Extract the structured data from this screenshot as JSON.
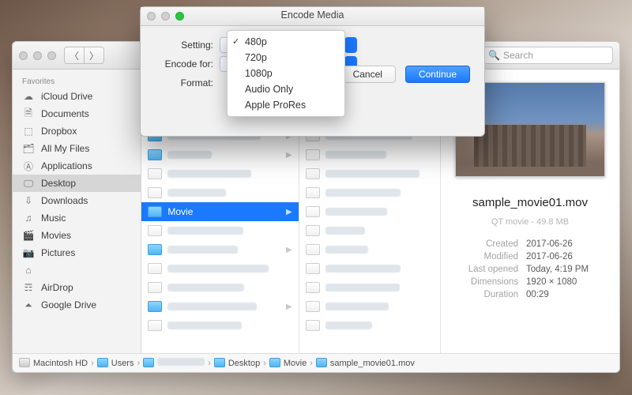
{
  "finder": {
    "search_placeholder": "Search",
    "sidebar": {
      "header": "Favorites",
      "items": [
        {
          "label": "iCloud Drive",
          "icon": "cloud"
        },
        {
          "label": "Documents",
          "icon": "doc"
        },
        {
          "label": "Dropbox",
          "icon": "dropbox"
        },
        {
          "label": "All My Files",
          "icon": "allfiles"
        },
        {
          "label": "Applications",
          "icon": "apps"
        },
        {
          "label": "Desktop",
          "icon": "desktop"
        },
        {
          "label": "Downloads",
          "icon": "downloads"
        },
        {
          "label": "Music",
          "icon": "music"
        },
        {
          "label": "Movies",
          "icon": "movies"
        },
        {
          "label": "Pictures",
          "icon": "pictures"
        },
        {
          "label": "",
          "icon": "home"
        },
        {
          "label": "AirDrop",
          "icon": "airdrop"
        },
        {
          "label": "Google Drive",
          "icon": "gdrive"
        }
      ],
      "selected_index": 5
    },
    "selected_folder": "Movie",
    "preview": {
      "filename": "sample_movie01.mov",
      "kind_line": "QT movie - 49.8 MB",
      "rows": [
        {
          "label": "Created",
          "value": "2017-06-26"
        },
        {
          "label": "Modified",
          "value": "2017-06-26"
        },
        {
          "label": "Last opened",
          "value": "Today, 4:19 PM"
        },
        {
          "label": "Dimensions",
          "value": "1920 × 1080"
        },
        {
          "label": "Duration",
          "value": "00:29"
        }
      ]
    },
    "path": [
      "Macintosh HD",
      "Users",
      "",
      "Desktop",
      "Movie",
      "sample_movie01.mov"
    ]
  },
  "dialog": {
    "title": "Encode Media",
    "labels": [
      "Setting:",
      "Encode for:",
      "Format:"
    ],
    "cancel": "Cancel",
    "continue": "Continue",
    "menu": {
      "options": [
        "480p",
        "720p",
        "1080p",
        "Audio Only",
        "Apple ProRes"
      ],
      "selected_index": 0
    }
  }
}
